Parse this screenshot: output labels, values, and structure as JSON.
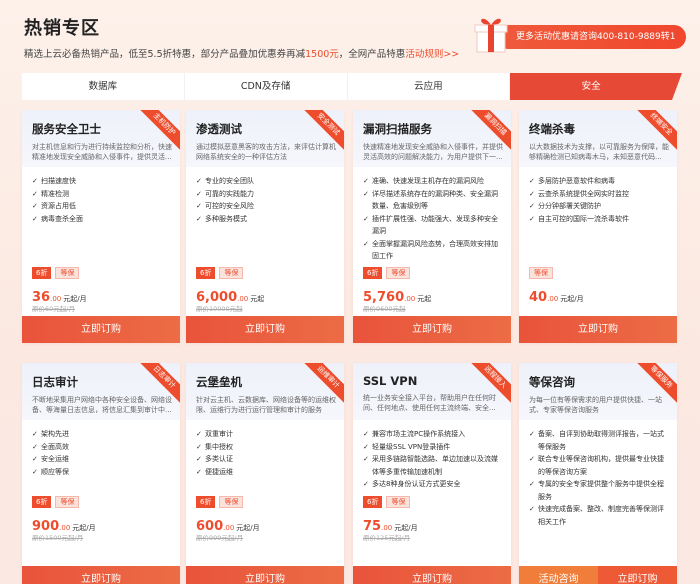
{
  "header": {
    "title": "热销专区",
    "subtitle_pre": "精选上云必备热销产品，低至5.5折特惠，部分产品叠加优惠券再减",
    "subtitle_amount": "1500元",
    "subtitle_mid": "，全网产品特惠",
    "subtitle_link": "活动规则>>",
    "promo_text": "更多活动优惠请咨询400-810-9889转1"
  },
  "tabs": [
    {
      "label": "数据库",
      "active": false
    },
    {
      "label": "CDN及存储",
      "active": false
    },
    {
      "label": "云应用",
      "active": false
    },
    {
      "label": "安全",
      "active": true
    }
  ],
  "cards": [
    {
      "name": "服务安全卫士",
      "desc": "对主机信息和行为进行持续监控和分析，快速精准地发现安全威胁和入侵事件，提供灵活...",
      "ribbon": "主机防护",
      "features": [
        "扫描速度快",
        "精准检测",
        "资源占用低",
        "病毒查杀全面"
      ],
      "badges": [
        "6折",
        "等保"
      ],
      "price": "36",
      "price_dec": ".00",
      "price_unit": "元起/月",
      "orig": "原价60元起/月",
      "buy": "立即订购"
    },
    {
      "name": "渗透测试",
      "desc": "通过模拟恶意黑客的攻击方法，来评估计算机网络系统安全的一种评估方法",
      "ribbon": "安全测试",
      "features": [
        "专业的安全团队",
        "可靠的实践能力",
        "可控的安全风险",
        "多种服务模式"
      ],
      "badges": [
        "6折",
        "等保"
      ],
      "price": "6,000",
      "price_dec": ".00",
      "price_unit": "元起",
      "orig": "原价10000元起",
      "buy": "立即订购"
    },
    {
      "name": "漏洞扫描服务",
      "desc": "快速精准地发现安全威胁和入侵事件，并提供灵活高效的问题解决能力，为用户提供下一...",
      "ribbon": "漏洞扫描",
      "features": [
        "准确、快速发现主机存在的漏洞风险",
        "详尽描述系统存在的漏洞种类、安全漏洞数量、危害级别等",
        "插件扩展性强、功能强大、发现多种安全漏洞",
        "全面掌握漏洞风险态势，合理高效安排加固工作"
      ],
      "badges": [
        "6折",
        "等保"
      ],
      "price": "5,760",
      "price_dec": ".00",
      "price_unit": "元起",
      "orig": "原价9600元起",
      "buy": "立即订购"
    },
    {
      "name": "终端杀毒",
      "desc": "以大数据技术为支撑，以可靠服务为保障，能够精确检测已知病毒木马，未知恶意代码...",
      "ribbon": "终端安全",
      "features": [
        "多层防护恶意软件和病毒",
        "云查杀系统提供全网实时监控",
        "分分钟部署关键防护",
        "自主可控的国际一流杀毒软件"
      ],
      "badges": [
        "等保"
      ],
      "price": "40",
      "price_dec": ".00",
      "price_unit": "元起/月",
      "orig": "",
      "buy": "立即订购"
    },
    {
      "name": "日志审计",
      "desc": "不断地采集用户网络中各种安全设备、网络设备、等海量日志信息，将信息汇集到审计中...",
      "ribbon": "日志审计",
      "features": [
        "架构先进",
        "全面高效",
        "安全运维",
        "顺应等保"
      ],
      "badges": [
        "6折",
        "等保"
      ],
      "price": "900",
      "price_dec": ".00",
      "price_unit": "元起/月",
      "orig": "原价1500元起/月",
      "buy": "立即订购"
    },
    {
      "name": "云堡垒机",
      "desc": "针对云主机、云数据库、网络设备等的运维权限、运维行为进行运行管理和审计的服务",
      "ribbon": "运维审计",
      "features": [
        "双重审计",
        "集中授权",
        "多类认证",
        "便捷运维"
      ],
      "badges": [
        "6折",
        "等保"
      ],
      "price": "600",
      "price_dec": ".00",
      "price_unit": "元起/月",
      "orig": "原价999元起/月",
      "buy": "立即订购"
    },
    {
      "name": "SSL VPN",
      "desc": "统一业务安全接入平台，帮助用户在任何时间、任何地点、使用任何主流终端、安全...",
      "ribbon": "远程接入",
      "features": [
        "兼容市场主流PC操作系统接入",
        "轻量级SSL VPN登录插件",
        "采用多链路智能选路、单边加速以及流媒体等多重传输加速机制",
        "多达8种身份认证方式更安全"
      ],
      "badges": [
        "6折",
        "等保"
      ],
      "price": "75",
      "price_dec": ".00",
      "price_unit": "元起/月",
      "orig": "原价125元起/月",
      "buy": "立即订购"
    },
    {
      "name": "等保咨询",
      "desc": "为每一位有等保需求的用户提供快捷、一站式、专家等保咨询服务",
      "ribbon": "等保服务",
      "features": [
        "备案、自评到协助取得测评报告，一站式等保服务",
        "联合专业等保咨询机构，提供最专业快捷的等保咨询方案",
        "专属的安全专家提供整个服务中提供全程服务",
        "快速完成备案、整改、制度完善等保测评相关工作"
      ],
      "badges": [],
      "price": "",
      "price_dec": "",
      "price_unit": "",
      "orig": "",
      "consult": "活动咨询",
      "buy": "立即订购"
    }
  ],
  "colors": {
    "accent": "#ee4d2d",
    "tab_active": "#e64a36",
    "consult": "#f07e3a"
  }
}
